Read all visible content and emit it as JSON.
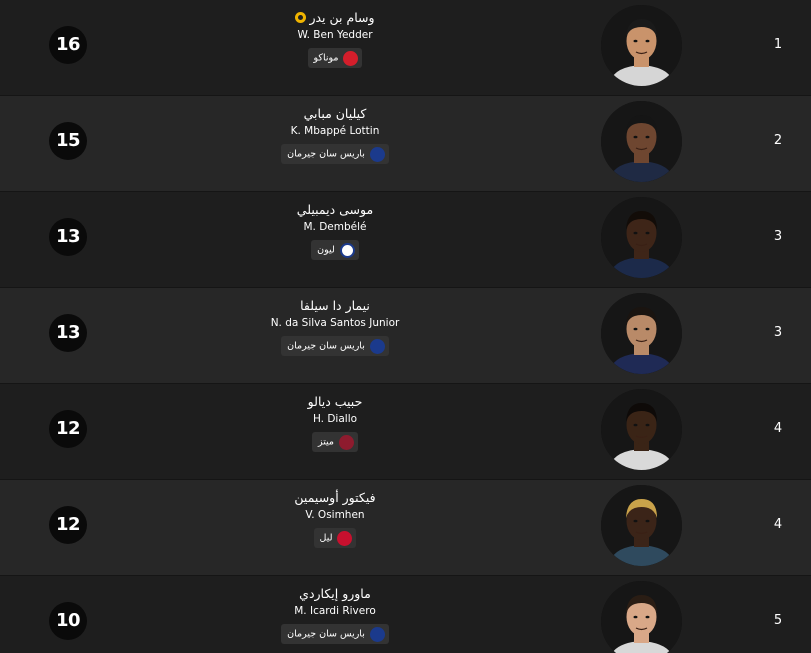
{
  "players": [
    {
      "rank": "1",
      "goals": "16",
      "name_ar": "وسام بن يدر",
      "name_en": "W. Ben Yedder",
      "team": "موناكو",
      "top_scorer_icon": "football-icon",
      "crest_icon": "monaco-crest-icon",
      "crest_color": "#d41e2b",
      "skin": "#c9936b",
      "hair": "#1a1a1a",
      "shirt": "#d6d6d6"
    },
    {
      "rank": "2",
      "goals": "15",
      "name_ar": "كيليان مبابي",
      "name_en": "K. Mbappé Lottin",
      "team": "باريس سان جيرمان",
      "top_scorer_icon": "",
      "crest_icon": "psg-crest-icon",
      "crest_color": "#1b3a8c",
      "skin": "#6e4630",
      "hair": "#151515",
      "shirt": "#1f2a44"
    },
    {
      "rank": "3",
      "goals": "13",
      "name_ar": "موسى ديمبيلي",
      "name_en": "M. Dembélé",
      "team": "ليون",
      "top_scorer_icon": "",
      "crest_icon": "lyon-crest-icon",
      "crest_color": "#ffffff",
      "skin": "#3e2518",
      "hair": "#120c08",
      "shirt": "#1c2a4a"
    },
    {
      "rank": "3",
      "goals": "13",
      "name_ar": "نيمار دا سيلفا",
      "name_en": "N. da Silva Santos Junior",
      "team": "باريس سان جيرمان",
      "top_scorer_icon": "",
      "crest_icon": "psg-crest-icon",
      "crest_color": "#1b3a8c",
      "skin": "#b98a68",
      "hair": "#1a1410",
      "shirt": "#1f2a55"
    },
    {
      "rank": "4",
      "goals": "12",
      "name_ar": "حبيب ديالو",
      "name_en": "H. Diallo",
      "team": "ميتز",
      "top_scorer_icon": "",
      "crest_icon": "metz-crest-icon",
      "crest_color": "#8e1b2e",
      "skin": "#3a2416",
      "hair": "#0e0a08",
      "shirt": "#d9d9d9"
    },
    {
      "rank": "4",
      "goals": "12",
      "name_ar": "فيكتور أوسيمين",
      "name_en": "V. Osimhen",
      "team": "ليل",
      "top_scorer_icon": "",
      "crest_icon": "lille-crest-icon",
      "crest_color": "#c8102e",
      "skin": "#3b2418",
      "hair": "#c9a24a",
      "shirt": "#2f4a5e"
    },
    {
      "rank": "5",
      "goals": "10",
      "name_ar": "ماورو إيكاردي",
      "name_en": "M. Icardi Rivero",
      "team": "باريس سان جيرمان",
      "top_scorer_icon": "",
      "crest_icon": "psg-crest-icon",
      "crest_color": "#1b3a8c",
      "skin": "#d9a888",
      "hair": "#2a1d14",
      "shirt": "#d8d8d8"
    }
  ]
}
